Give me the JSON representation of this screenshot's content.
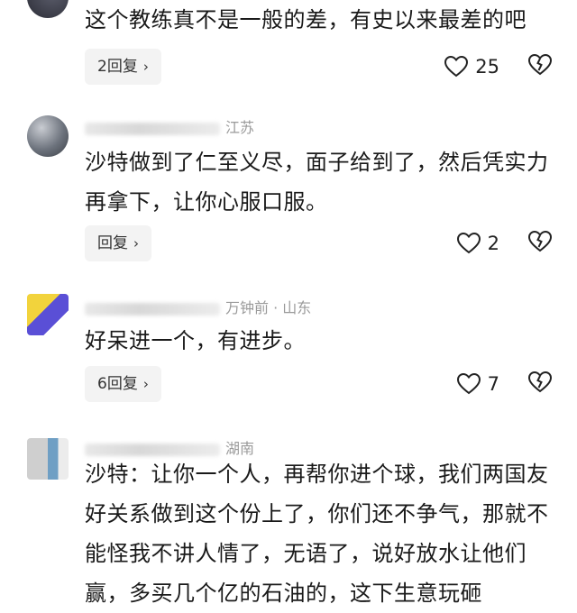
{
  "comments": [
    {
      "meta": "",
      "text": "这个教练真不是一般的差，有史以来最差的吧",
      "reply_label": "2回复",
      "likes": "25"
    },
    {
      "meta": "江苏",
      "text": "沙特做到了仁至义尽，面子给到了，然后凭实力再拿下，让你心服口服。",
      "reply_label": "回复",
      "likes": "2"
    },
    {
      "meta": "万钟前 · 山东",
      "text": "好呆进一个，有进步。",
      "reply_label": "6回复",
      "likes": "7"
    },
    {
      "meta": "湖南",
      "text": "沙特：让你一个人，再帮你进个球，我们两国友好关系做到这个份上了，你们还不争气，那就不能怪我不讲人情了，无语了，说好放水让他们赢，多买几个亿的石油的，这下生意玩砸",
      "reply_label": "",
      "likes": ""
    }
  ],
  "icons": {
    "reply_chevron": "chevron-right-icon",
    "like": "heart-icon",
    "dislike": "broken-heart-icon"
  },
  "colors": {
    "text": "#1a1a1a",
    "meta": "#9a9a9a",
    "reply_bg": "#f3f3f3"
  }
}
